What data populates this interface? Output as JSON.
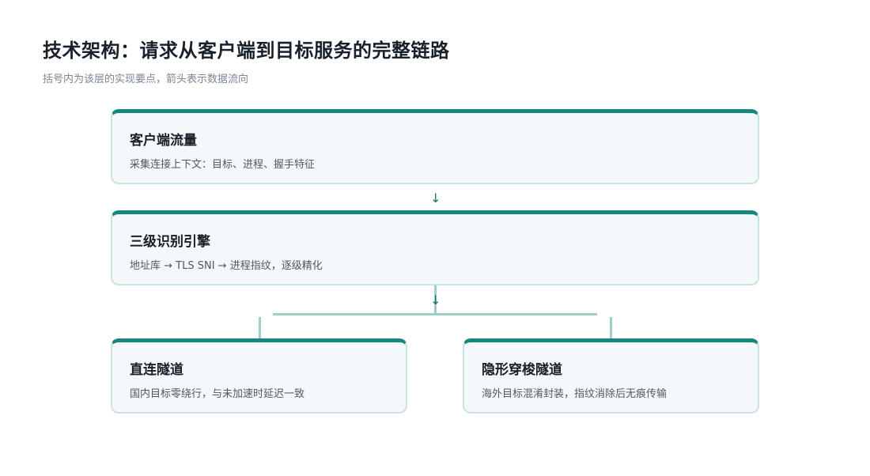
{
  "header": {
    "title": "技术架构：请求从客户端到目标服务的完整链路",
    "subtitle": "括号内为该层的实现要点，箭头表示数据流向"
  },
  "flow": {
    "client": {
      "title": "客户端流量",
      "desc": "采集连接上下文：目标、进程、握手特征"
    },
    "engine": {
      "title": "三级识别引擎",
      "desc": "地址库 → TLS SNI → 进程指纹，逐级精化"
    },
    "direct": {
      "title": "直连隧道",
      "desc": "国内目标零绕行，与未加速时延迟一致"
    },
    "stealth": {
      "title": "隐形穿梭隧道",
      "desc": "海外目标混淆封装，指纹消除后无痕传输"
    },
    "arrow_glyph": "↓"
  },
  "colors": {
    "accent": "#16877c",
    "card_border": "#c8e4e2",
    "card_bg": "#f5f8fa",
    "connector": "#9fcfca"
  }
}
